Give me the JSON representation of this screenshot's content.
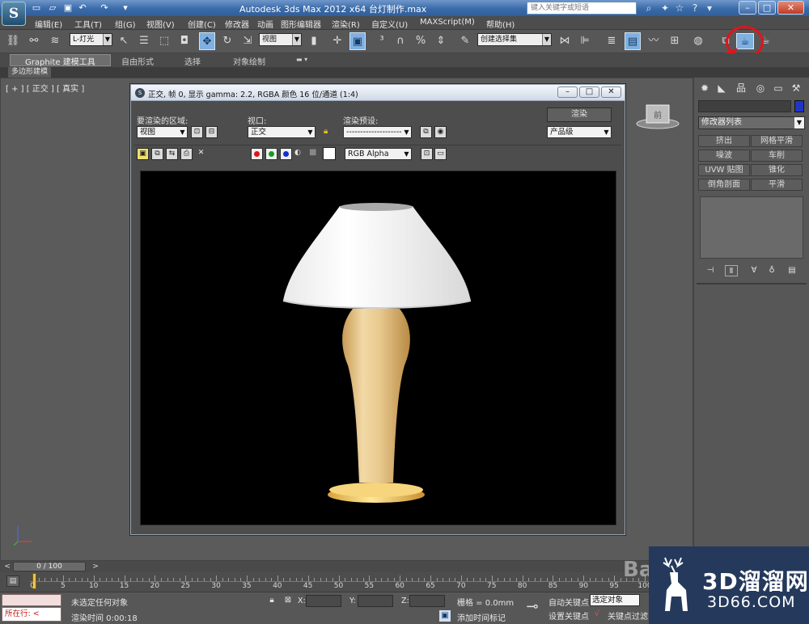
{
  "window": {
    "title": "Autodesk 3ds Max  2012 x64 台灯制作.max",
    "app_logo": "S",
    "search_placeholder": "键入关键字或短语",
    "minimize": "–",
    "maximize": "□",
    "close": "✕"
  },
  "menu": [
    "编辑(E)",
    "工具(T)",
    "组(G)",
    "视图(V)",
    "创建(C)",
    "修改器",
    "动画",
    "图形编辑器",
    "渲染(R)",
    "自定义(U)",
    "MAXScript(M)",
    "帮助(H)"
  ],
  "toolbar": {
    "selection_filter": "L-灯光",
    "reference_coord": "视图",
    "named_selection": "创建选择集"
  },
  "ribbon": {
    "tabs": [
      "Graphite 建模工具",
      "自由形式",
      "选择",
      "对象绘制"
    ],
    "sub_label": "多边形建模"
  },
  "viewport": {
    "label": "[ + ] [ 正交 ] [ 真实 ]",
    "viewcube_label": "前"
  },
  "command_panel": {
    "modifier_list": "修改器列表",
    "modifier_buttons": [
      "挤出",
      "网格平滑",
      "噪波",
      "车削",
      "UVW 贴图",
      "锥化",
      "倒角剖面",
      "平滑"
    ]
  },
  "render_window": {
    "title": "正交, 帧 0, 显示 gamma: 2.2, RGBA 颜色 16 位/通道 (1:4)",
    "area_label": "要渲染的区域:",
    "area_value": "视图",
    "viewport_label": "视口:",
    "viewport_value": "正交",
    "preset_label": "渲染预设:",
    "preset_value": "--------------------",
    "render_button": "渲染",
    "quality_value": "产品级",
    "channel_value": "RGB Alpha",
    "colors": {
      "red": "#e01515",
      "green": "#12a020",
      "blue": "#1030d0"
    }
  },
  "timeline": {
    "position": "0 / 100",
    "prev": "<",
    "next": ">",
    "ticks": [
      0,
      5,
      10,
      15,
      20,
      25,
      30,
      35,
      40,
      45,
      50,
      55,
      60,
      65,
      70,
      75,
      80,
      85,
      90,
      95,
      100
    ]
  },
  "statusbar": {
    "listener_text": "所在行:",
    "status": "未选定任何对象",
    "render_time": "渲染时间  0:00:18",
    "x_label": "X:",
    "y_label": "Y:",
    "z_label": "Z:",
    "grid": "栅格 = 0.0mm",
    "add_time_tag": "添加时间标记",
    "auto_key": "自动关键点",
    "set_key": "设置关键点",
    "selected_object": "选定对象",
    "key_filters": "关键点过滤"
  },
  "watermark": {
    "name": "3D溜溜网",
    "url": "3D66.COM",
    "baidu": "Bai"
  }
}
